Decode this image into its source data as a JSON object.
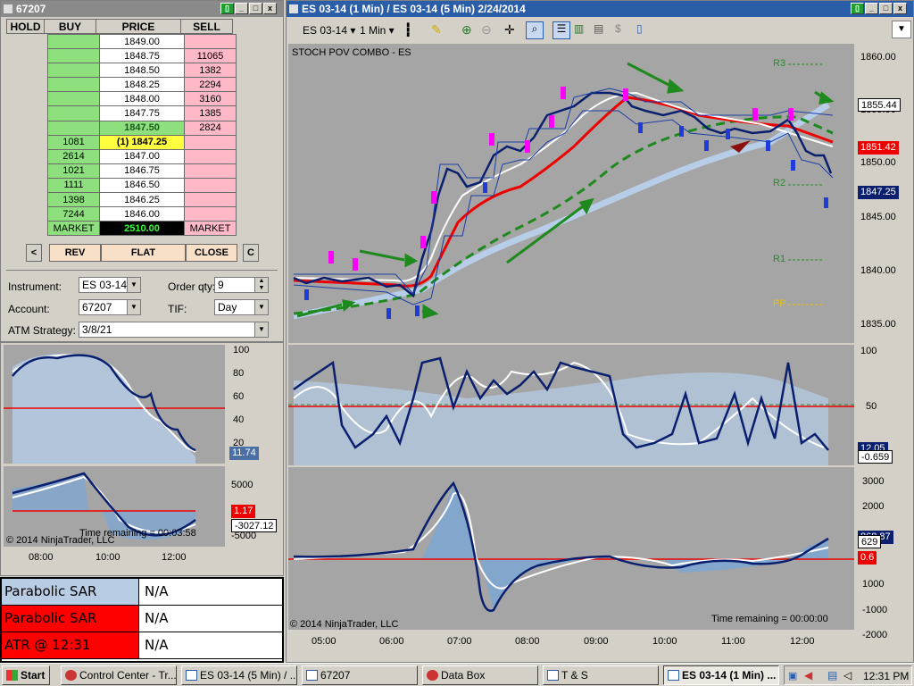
{
  "dom": {
    "title": "67207",
    "headers": [
      "HOLD",
      "BUY",
      "PRICE",
      "SELL"
    ],
    "rows": [
      {
        "buy": "",
        "price": "1849.00",
        "sell": ""
      },
      {
        "buy": "",
        "price": "1848.75",
        "sell": "11065"
      },
      {
        "buy": "",
        "price": "1848.50",
        "sell": "1382"
      },
      {
        "buy": "",
        "price": "1848.25",
        "sell": "2294"
      },
      {
        "buy": "",
        "price": "1848.00",
        "sell": "3160"
      },
      {
        "buy": "",
        "price": "1847.75",
        "sell": "1385"
      },
      {
        "buy": "",
        "price": "1847.50",
        "sell": "2824"
      },
      {
        "buy": "1081",
        "price": "(1) 1847.25",
        "sell": ""
      },
      {
        "buy": "2614",
        "price": "1847.00",
        "sell": ""
      },
      {
        "buy": "1021",
        "price": "1846.75",
        "sell": ""
      },
      {
        "buy": "1111",
        "price": "1846.50",
        "sell": ""
      },
      {
        "buy": "1398",
        "price": "1846.25",
        "sell": ""
      },
      {
        "buy": "7244",
        "price": "1846.00",
        "sell": ""
      }
    ],
    "market_left": "MARKET",
    "market_price": "2510.00",
    "market_right": "MARKET",
    "buttons": {
      "lt": "<",
      "rev": "REV",
      "flat": "FLAT",
      "close": "CLOSE",
      "c": "C"
    },
    "instrument_label": "Instrument:",
    "instrument_value": "ES 03-14",
    "orderqty_label": "Order qty:",
    "orderqty_value": "9",
    "account_label": "Account:",
    "account_value": "67207",
    "tif_label": "TIF:",
    "tif_value": "Day",
    "atm_label": "ATM Strategy:",
    "atm_value": "3/8/21"
  },
  "minichart": {
    "axis1": [
      "100",
      "80",
      "60",
      "40",
      "20"
    ],
    "tag1": "11.74",
    "axis2": [
      "5000",
      "0",
      "-5000"
    ],
    "tag2a": "1.17",
    "tag2b": "-3027.12",
    "copyright": "© 2014 NinjaTrader, LLC",
    "time_remaining": "Time remaining = 00:03:58",
    "xlabels": [
      "08:00",
      "10:00",
      "12:00"
    ]
  },
  "databox": {
    "rows": [
      {
        "name": "Parabolic SAR",
        "value": "N/A",
        "color": "#b8cce4"
      },
      {
        "name": "Parabolic SAR",
        "value": "N/A",
        "color": "#ff0000"
      },
      {
        "name": "ATR @ 12:31",
        "value": "N/A",
        "color": "#ff0000"
      }
    ]
  },
  "chart": {
    "title": "ES 03-14 (1 Min) / ES 03-14 (5 Min)  2/24/2014",
    "instrument": "ES 03-14",
    "interval": "1 Min",
    "indicator_label": "STOCH POV COMBO - ES",
    "price_axis": [
      "1860.00",
      "1855.00",
      "1850.00",
      "1845.00",
      "1840.00",
      "1835.00"
    ],
    "pivot_labels": {
      "r3": "R3",
      "r2": "R2",
      "r1": "R1",
      "pp": "PP"
    },
    "tags": {
      "t1": "1855.44",
      "t2": "1851.42",
      "t3": "1847.25"
    },
    "stoch_axis": [
      "100",
      "50"
    ],
    "stoch_tags": {
      "a": "12.05",
      "b": "-0.659"
    },
    "macd_axis": [
      "3000",
      "2000",
      "1000",
      "-1000",
      "-2000"
    ],
    "macd_tags": {
      "a": "868.87",
      "b": "629",
      "c": "0.6"
    },
    "copyright": "© 2014 NinjaTrader, LLC",
    "time_remaining": "Time remaining = 00:00:00",
    "xlabels": [
      "05:00",
      "06:00",
      "07:00",
      "08:00",
      "09:00",
      "10:00",
      "11:00",
      "12:00"
    ]
  },
  "taskbar": {
    "start": "Start",
    "items": [
      "Control Center - Tr...",
      "ES 03-14 (5 Min) / ...",
      "67207",
      "Data Box",
      "T & S",
      "ES 03-14 (1 Min) ..."
    ],
    "clock": "12:31 PM"
  },
  "colors": {
    "buy": "#8edf7e",
    "sell": "#ffb8c8",
    "pane": "#a5a5a5",
    "accent": "#2a5ea8"
  }
}
